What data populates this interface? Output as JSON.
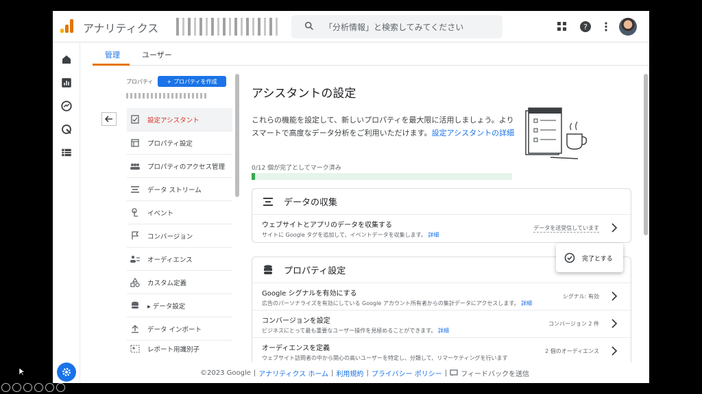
{
  "topbar": {
    "app_name": "アナリティクス",
    "search_placeholder": "「分析情報」と検索してみてください",
    "icons": [
      "apps-grid-icon",
      "help-icon",
      "more-vert-icon"
    ]
  },
  "tabs": [
    {
      "label": "管理",
      "active": true
    },
    {
      "label": "ユーザー",
      "active": false
    }
  ],
  "property": {
    "label": "プロパティ",
    "create_button": "プロパティを作成"
  },
  "nav": [
    {
      "label": "設定アシスタント",
      "icon": "checklist-icon",
      "active": true
    },
    {
      "label": "プロパティ設定",
      "icon": "layout-icon",
      "active": false
    },
    {
      "label": "プロパティのアクセス管理",
      "icon": "people-icon",
      "active": false
    },
    {
      "label": "データ ストリーム",
      "icon": "stream-icon",
      "active": false
    },
    {
      "label": "イベント",
      "icon": "touch-icon",
      "active": false
    },
    {
      "label": "コンバージョン",
      "icon": "flag-icon",
      "active": false
    },
    {
      "label": "オーディエンス",
      "icon": "audience-icon",
      "active": false
    },
    {
      "label": "カスタム定義",
      "icon": "shapes-icon",
      "active": false
    },
    {
      "label": "▸ データ設定",
      "icon": "database-icon",
      "active": false
    },
    {
      "label": "データ インポート",
      "icon": "upload-icon",
      "active": false
    },
    {
      "label": "レポート用識別子",
      "icon": "identifier-icon",
      "active": false
    }
  ],
  "main": {
    "title": "アシスタントの設定",
    "intro_text": "これらの機能を設定して、新しいプロパティを最大限に活用しましょう。よりスマートで高度なデータ分析をご利用いただけます。",
    "intro_link": "設定アシスタントの詳細",
    "progress_label": "0/12 個が完了としてマーク済み",
    "progress_value": 0,
    "progress_total": 12
  },
  "cards": [
    {
      "title": "データの収集",
      "icon": "stream-icon",
      "rows": [
        {
          "title": "ウェブサイトとアプリのデータを収集する",
          "desc": "サイトに Google タグを追加して、イベントデータを収集します。",
          "link": "詳細",
          "status": "データを送受信しています"
        }
      ]
    },
    {
      "title": "プロパティ設定",
      "icon": "database-icon",
      "rows": [
        {
          "title": "Google シグナルを有効にする",
          "desc": "広告のパーソナライズを有効にしている Google アカウント所有者からの集計データにアクセスします。",
          "link": "詳細",
          "status": "シグナル: 有効"
        },
        {
          "title": "コンバージョンを設定",
          "desc": "ビジネスにとって最も重要なユーザー操作を見極めることができます。",
          "link": "詳細",
          "status": "コンバージョン 2 件"
        },
        {
          "title": "オーディエンスを定義",
          "desc": "ウェブサイト訪問者の中から関心の高いユーザーを特定し、分類して、リマーケティングを行います",
          "link": "",
          "status": "2 個のオーディエンス"
        }
      ]
    }
  ],
  "popup": {
    "label": "完了とする"
  },
  "footer": {
    "copyright": "©2023 Google",
    "links": [
      "アナリティクス ホーム",
      "利用規約",
      "プライバシー ポリシー"
    ],
    "feedback": "フィードバックを送信",
    "separator": "|"
  },
  "colors": {
    "accent": "#1a73e8",
    "active_nav": "#d93025",
    "progress": "#34a853",
    "tab_underline": "#e37400"
  }
}
